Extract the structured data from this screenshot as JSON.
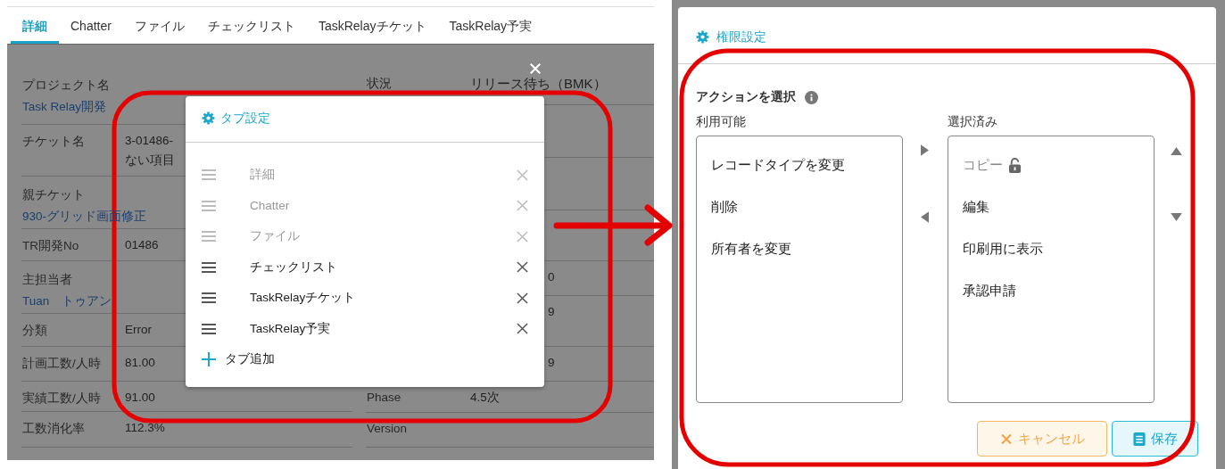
{
  "left_screen": {
    "tabs": [
      {
        "label": "詳細",
        "selected": true
      },
      {
        "label": "Chatter",
        "selected": false
      },
      {
        "label": "ファイル",
        "selected": false
      },
      {
        "label": "チェックリスト",
        "selected": false
      },
      {
        "label": "TaskRelayチケット",
        "selected": false
      },
      {
        "label": "TaskRelay予実",
        "selected": false
      }
    ],
    "fields_left": [
      {
        "kind": "link",
        "label": "プロジェクト名",
        "value": "Task Relay開発"
      },
      {
        "kind": "text",
        "label": "チケット名",
        "value": "3-01486-\nない項目"
      },
      {
        "kind": "link",
        "label": "親チケット",
        "value": "930-グリッド画面修正"
      },
      {
        "kind": "text",
        "label": "TR開発No",
        "value": "01486"
      },
      {
        "kind": "link",
        "label": "主担当者",
        "value": "Tuan　トゥアン"
      },
      {
        "kind": "text",
        "label": "分類",
        "value": "Error"
      },
      {
        "kind": "text",
        "label": "計画工数/人時",
        "value": "81.00"
      },
      {
        "kind": "text",
        "label": "実績工数/人時",
        "value": "91.00"
      },
      {
        "kind": "text",
        "label": "工数消化率",
        "value": "112.3%"
      }
    ],
    "fields_right": [
      {
        "label": "状況",
        "value": "リリース待ち（BMK）"
      },
      {
        "kind": "partial",
        "value": "0"
      },
      {
        "kind": "partial",
        "value": "9"
      },
      {
        "kind": "partial",
        "value": "9"
      },
      {
        "label": "Phase",
        "value": "4.5次"
      },
      {
        "label": "Version"
      }
    ],
    "tab_settings_dialog": {
      "title": "タブ設定",
      "items": [
        {
          "label": "詳細",
          "disabled": true
        },
        {
          "label": "Chatter",
          "disabled": true
        },
        {
          "label": "ファイル",
          "disabled": true
        },
        {
          "label": "チェックリスト",
          "disabled": false
        },
        {
          "label": "TaskRelayチケット",
          "disabled": false
        },
        {
          "label": "TaskRelay予実",
          "disabled": false
        }
      ],
      "add_label": "タブ追加"
    }
  },
  "right_screen": {
    "dialog": {
      "title": "権限設定",
      "section_title": "アクションを選択",
      "available": {
        "label": "利用可能",
        "items": [
          "レコードタイプを変更",
          "削除",
          "所有者を変更"
        ]
      },
      "selected": {
        "label": "選択済み",
        "items": [
          {
            "label": "コピー",
            "locked": true
          },
          {
            "label": "編集",
            "locked": false
          },
          {
            "label": "印刷用に表示",
            "locked": false
          },
          {
            "label": "承認申請",
            "locked": false
          }
        ]
      },
      "buttons": [
        {
          "kind": "cancel",
          "label": "キャンセル"
        },
        {
          "kind": "save",
          "label": "保存"
        }
      ]
    }
  }
}
